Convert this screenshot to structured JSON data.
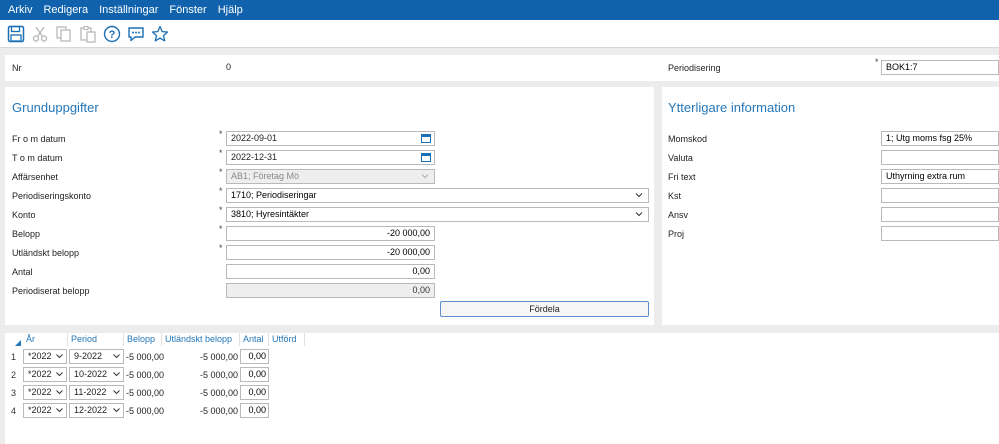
{
  "menu": [
    "Arkiv",
    "Redigera",
    "Inställningar",
    "Fönster",
    "Hjälp"
  ],
  "header": {
    "nr_label": "Nr",
    "nr_value": "0",
    "periodisering_label": "Periodisering",
    "periodisering_value": "BOK1:7"
  },
  "grund": {
    "title": "Grunduppgifter",
    "from_label": "Fr o m datum",
    "from_value": "2022-09-01",
    "tom_label": "T o m datum",
    "tom_value": "2022-12-31",
    "affarsenhet_label": "Affärsenhet",
    "affarsenhet_value": "AB1; Företag Mö",
    "periodiseringskonto_label": "Periodiseringskonto",
    "periodiseringskonto_value": "1710; Periodiseringar",
    "konto_label": "Konto",
    "konto_value": "3810; Hyresintäkter",
    "belopp_label": "Belopp",
    "belopp_value": "-20 000,00",
    "utl_label": "Utländskt belopp",
    "utl_value": "-20 000,00",
    "antal_label": "Antal",
    "antal_value": "0,00",
    "periodiserat_label": "Periodiserat belopp",
    "periodiserat_value": "0,00",
    "fordela_label": "Fördela"
  },
  "ytter": {
    "title": "Ytterligare information",
    "momskod_label": "Momskod",
    "momskod_value": "1; Utg moms fsg 25%",
    "valuta_label": "Valuta",
    "valuta_value": "",
    "fritext_label": "Fri text",
    "fritext_value": "Uthyrning extra rum",
    "kst_label": "Kst",
    "kst_value": "",
    "ansv_label": "Ansv",
    "ansv_value": "",
    "proj_label": "Proj",
    "proj_value": ""
  },
  "grid": {
    "headers": [
      "År",
      "Period",
      "Belopp",
      "Utländskt belopp",
      "Antal",
      "Utförd"
    ],
    "rows": [
      {
        "n": "1",
        "ar": "*2022",
        "period": "9-2022",
        "belopp": "-5 000,00",
        "utl": "-5 000,00",
        "antal": "0,00"
      },
      {
        "n": "2",
        "ar": "*2022",
        "period": "10-2022",
        "belopp": "-5 000,00",
        "utl": "-5 000,00",
        "antal": "0,00"
      },
      {
        "n": "3",
        "ar": "*2022",
        "period": "11-2022",
        "belopp": "-5 000,00",
        "utl": "-5 000,00",
        "antal": "0,00"
      },
      {
        "n": "4",
        "ar": "*2022",
        "period": "12-2022",
        "belopp": "-5 000,00",
        "utl": "-5 000,00",
        "antal": "0,00"
      }
    ]
  },
  "icons": [
    "save-icon",
    "cut-icon",
    "copy-icon",
    "paste-icon",
    "help-icon",
    "comment-icon",
    "favorite-icon"
  ],
  "colors": {
    "menubar": "#0f62ab",
    "accent": "#2577b8"
  }
}
